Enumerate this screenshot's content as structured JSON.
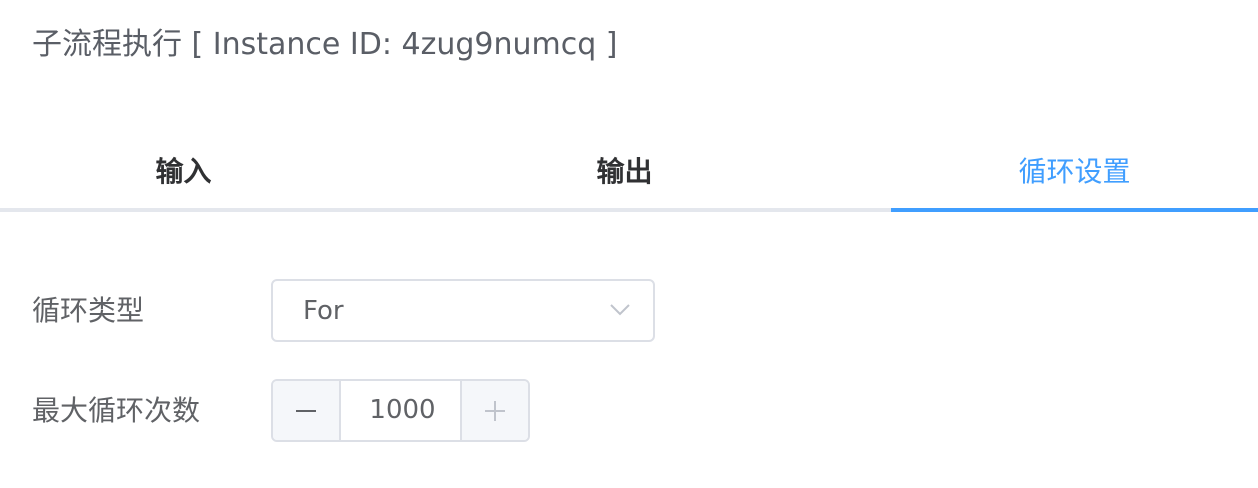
{
  "header": {
    "title": "子流程执行 [ Instance ID: 4zug9numcq ]"
  },
  "tabs": [
    {
      "label": "输入",
      "active": false
    },
    {
      "label": "输出",
      "active": false
    },
    {
      "label": "循环设置",
      "active": true
    }
  ],
  "form": {
    "loop_type": {
      "label": "循环类型",
      "value": "For",
      "icon": "chevron-down-icon"
    },
    "max_loops": {
      "label": "最大循环次数",
      "value": "1000",
      "minus_icon": "minus-icon",
      "plus_icon": "plus-icon"
    }
  },
  "colors": {
    "accent": "#409eff",
    "text": "#303133",
    "muted": "#606266",
    "border": "#dcdfe6",
    "stepper_bg": "#f5f7fa"
  }
}
